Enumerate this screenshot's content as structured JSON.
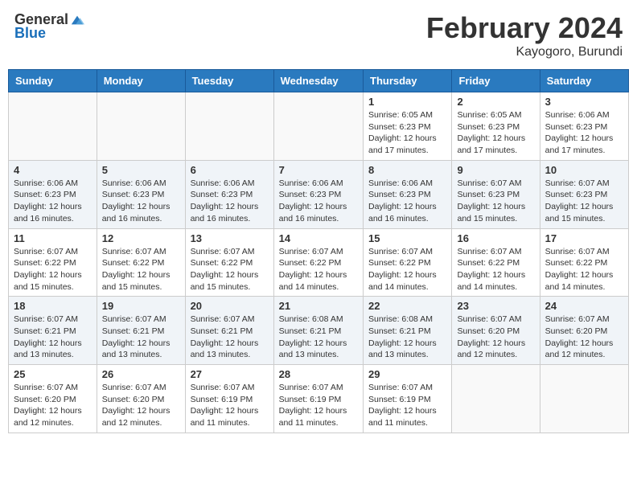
{
  "logo": {
    "general": "General",
    "blue": "Blue"
  },
  "title": "February 2024",
  "subtitle": "Kayogoro, Burundi",
  "days_of_week": [
    "Sunday",
    "Monday",
    "Tuesday",
    "Wednesday",
    "Thursday",
    "Friday",
    "Saturday"
  ],
  "weeks": [
    {
      "bg": "even",
      "days": [
        {
          "number": "",
          "info": "",
          "empty": true
        },
        {
          "number": "",
          "info": "",
          "empty": true
        },
        {
          "number": "",
          "info": "",
          "empty": true
        },
        {
          "number": "",
          "info": "",
          "empty": true
        },
        {
          "number": "1",
          "info": "Sunrise: 6:05 AM\nSunset: 6:23 PM\nDaylight: 12 hours and 17 minutes."
        },
        {
          "number": "2",
          "info": "Sunrise: 6:05 AM\nSunset: 6:23 PM\nDaylight: 12 hours and 17 minutes."
        },
        {
          "number": "3",
          "info": "Sunrise: 6:06 AM\nSunset: 6:23 PM\nDaylight: 12 hours and 17 minutes."
        }
      ]
    },
    {
      "bg": "odd",
      "days": [
        {
          "number": "4",
          "info": "Sunrise: 6:06 AM\nSunset: 6:23 PM\nDaylight: 12 hours and 16 minutes."
        },
        {
          "number": "5",
          "info": "Sunrise: 6:06 AM\nSunset: 6:23 PM\nDaylight: 12 hours and 16 minutes."
        },
        {
          "number": "6",
          "info": "Sunrise: 6:06 AM\nSunset: 6:23 PM\nDaylight: 12 hours and 16 minutes."
        },
        {
          "number": "7",
          "info": "Sunrise: 6:06 AM\nSunset: 6:23 PM\nDaylight: 12 hours and 16 minutes."
        },
        {
          "number": "8",
          "info": "Sunrise: 6:06 AM\nSunset: 6:23 PM\nDaylight: 12 hours and 16 minutes."
        },
        {
          "number": "9",
          "info": "Sunrise: 6:07 AM\nSunset: 6:23 PM\nDaylight: 12 hours and 15 minutes."
        },
        {
          "number": "10",
          "info": "Sunrise: 6:07 AM\nSunset: 6:23 PM\nDaylight: 12 hours and 15 minutes."
        }
      ]
    },
    {
      "bg": "even",
      "days": [
        {
          "number": "11",
          "info": "Sunrise: 6:07 AM\nSunset: 6:22 PM\nDaylight: 12 hours and 15 minutes."
        },
        {
          "number": "12",
          "info": "Sunrise: 6:07 AM\nSunset: 6:22 PM\nDaylight: 12 hours and 15 minutes."
        },
        {
          "number": "13",
          "info": "Sunrise: 6:07 AM\nSunset: 6:22 PM\nDaylight: 12 hours and 15 minutes."
        },
        {
          "number": "14",
          "info": "Sunrise: 6:07 AM\nSunset: 6:22 PM\nDaylight: 12 hours and 14 minutes."
        },
        {
          "number": "15",
          "info": "Sunrise: 6:07 AM\nSunset: 6:22 PM\nDaylight: 12 hours and 14 minutes."
        },
        {
          "number": "16",
          "info": "Sunrise: 6:07 AM\nSunset: 6:22 PM\nDaylight: 12 hours and 14 minutes."
        },
        {
          "number": "17",
          "info": "Sunrise: 6:07 AM\nSunset: 6:22 PM\nDaylight: 12 hours and 14 minutes."
        }
      ]
    },
    {
      "bg": "odd",
      "days": [
        {
          "number": "18",
          "info": "Sunrise: 6:07 AM\nSunset: 6:21 PM\nDaylight: 12 hours and 13 minutes."
        },
        {
          "number": "19",
          "info": "Sunrise: 6:07 AM\nSunset: 6:21 PM\nDaylight: 12 hours and 13 minutes."
        },
        {
          "number": "20",
          "info": "Sunrise: 6:07 AM\nSunset: 6:21 PM\nDaylight: 12 hours and 13 minutes."
        },
        {
          "number": "21",
          "info": "Sunrise: 6:08 AM\nSunset: 6:21 PM\nDaylight: 12 hours and 13 minutes."
        },
        {
          "number": "22",
          "info": "Sunrise: 6:08 AM\nSunset: 6:21 PM\nDaylight: 12 hours and 13 minutes."
        },
        {
          "number": "23",
          "info": "Sunrise: 6:07 AM\nSunset: 6:20 PM\nDaylight: 12 hours and 12 minutes."
        },
        {
          "number": "24",
          "info": "Sunrise: 6:07 AM\nSunset: 6:20 PM\nDaylight: 12 hours and 12 minutes."
        }
      ]
    },
    {
      "bg": "even",
      "days": [
        {
          "number": "25",
          "info": "Sunrise: 6:07 AM\nSunset: 6:20 PM\nDaylight: 12 hours and 12 minutes."
        },
        {
          "number": "26",
          "info": "Sunrise: 6:07 AM\nSunset: 6:20 PM\nDaylight: 12 hours and 12 minutes."
        },
        {
          "number": "27",
          "info": "Sunrise: 6:07 AM\nSunset: 6:19 PM\nDaylight: 12 hours and 11 minutes."
        },
        {
          "number": "28",
          "info": "Sunrise: 6:07 AM\nSunset: 6:19 PM\nDaylight: 12 hours and 11 minutes."
        },
        {
          "number": "29",
          "info": "Sunrise: 6:07 AM\nSunset: 6:19 PM\nDaylight: 12 hours and 11 minutes."
        },
        {
          "number": "",
          "info": "",
          "empty": true
        },
        {
          "number": "",
          "info": "",
          "empty": true
        }
      ]
    }
  ]
}
